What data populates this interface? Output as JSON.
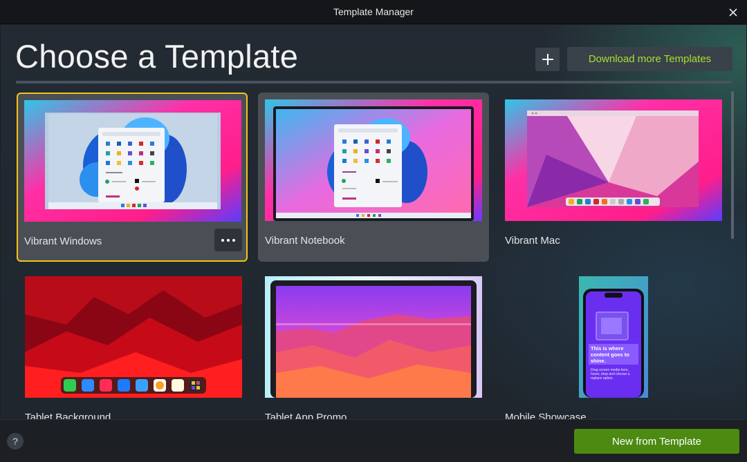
{
  "window": {
    "title": "Template Manager"
  },
  "header": {
    "heading": "Choose a Template",
    "download_label": "Download more Templates"
  },
  "templates": [
    {
      "label": "Vibrant Windows",
      "state": "selected"
    },
    {
      "label": "Vibrant Notebook",
      "state": "hover"
    },
    {
      "label": "Vibrant Mac",
      "state": "normal"
    },
    {
      "label": "Tablet Background",
      "state": "normal"
    },
    {
      "label": "Tablet App Promo",
      "state": "normal"
    },
    {
      "label": "Mobile Showcase",
      "state": "normal"
    }
  ],
  "mobile_preview": {
    "headline": "This is where content goes to shine.",
    "body": "Drag screen media here, hover, drop and choose a replace option."
  },
  "footer": {
    "help_label": "?",
    "new_label": "New from Template"
  },
  "colors": {
    "accent_green": "#a6e22e",
    "primary_button": "#4c8a12",
    "selection_border": "#f5c518"
  }
}
